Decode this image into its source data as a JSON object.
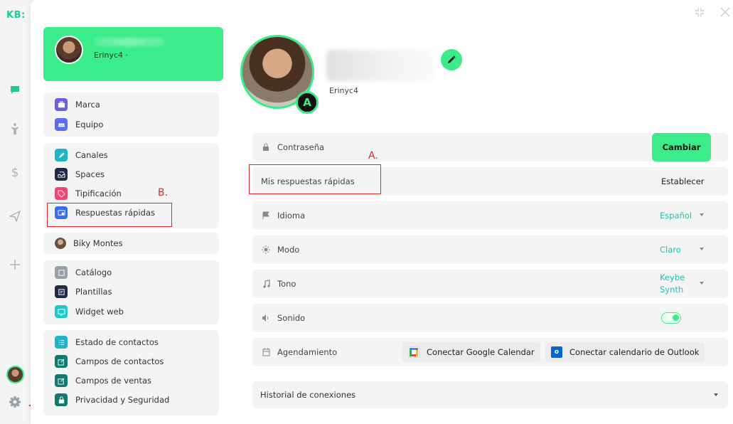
{
  "rail": {
    "logo": "KB:",
    "items": [
      "chat-icon",
      "people-icon",
      "dollar-icon",
      "send-icon",
      "plus-icon"
    ],
    "settings_icon": "gear-icon"
  },
  "profile": {
    "username": "Erinyc4 ·",
    "username_main": "Erinyc4",
    "badge": "A"
  },
  "sidebar": {
    "group1": [
      {
        "label": "Marca",
        "icon": "briefcase-icon",
        "color": "#6c5ce7"
      },
      {
        "label": "Equipo",
        "icon": "team-icon",
        "color": "#5b6df0"
      }
    ],
    "group2": [
      {
        "label": "Canales",
        "icon": "rocket-icon",
        "color": "#1fb5c9"
      },
      {
        "label": "Spaces",
        "icon": "inbox-icon",
        "color": "#1f2a44"
      },
      {
        "label": "Tipificación",
        "icon": "tag-icon",
        "color": "#ef476f"
      },
      {
        "label": "Respuestas rápidas",
        "icon": "quick-reply-icon",
        "color": "#3b6df0"
      }
    ],
    "group3": [
      {
        "label": "Biky Montes",
        "icon": "avatar"
      }
    ],
    "group4": [
      {
        "label": "Catálogo",
        "icon": "catalog-icon",
        "color": "#9aa0a6"
      },
      {
        "label": "Plantillas",
        "icon": "template-icon",
        "color": "#1f2a44"
      },
      {
        "label": "Widget web",
        "icon": "widget-icon",
        "color": "#1fc9c9"
      }
    ],
    "group5": [
      {
        "label": "Estado de contactos",
        "icon": "list-icon",
        "color": "#1fb5c9"
      },
      {
        "label": "Campos de contactos",
        "icon": "edit-icon",
        "color": "#0f7a6e"
      },
      {
        "label": "Campos de ventas",
        "icon": "edit-icon",
        "color": "#0f7a6e"
      },
      {
        "label": "Privacidad y Seguridad",
        "icon": "lock-icon",
        "color": "#0f7a6e"
      }
    ]
  },
  "annotations": {
    "a": "A.",
    "b": "B."
  },
  "settings": {
    "password_label": "Contraseña",
    "change_button": "Cambiar",
    "quick_replies_label": "Mis respuestas rápidas",
    "set_button": "Establecer",
    "language_label": "Idioma",
    "language_value": "Español",
    "mode_label": "Modo",
    "mode_value": "Claro",
    "tone_label": "Tono",
    "tone_value_1": "Keybe",
    "tone_value_2": "Synth",
    "sound_label": "Sonido",
    "sound_on": true,
    "scheduling_label": "Agendamiento",
    "google_button": "Conectar Google Calendar",
    "outlook_button": "Conectar calendario de Outlook",
    "history_label": "Historial de conexiones"
  }
}
